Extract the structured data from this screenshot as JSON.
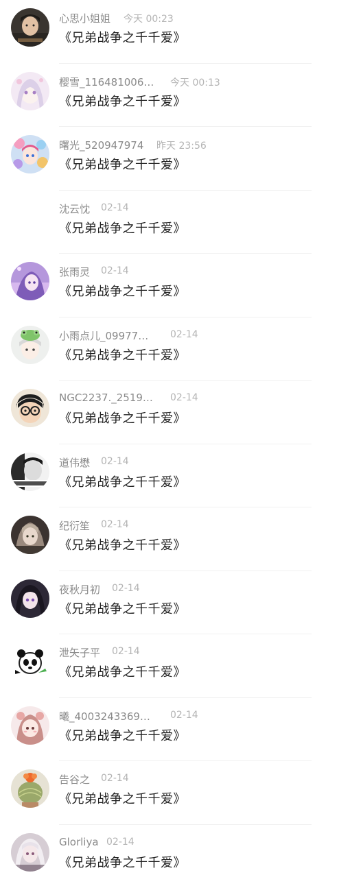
{
  "messages": [
    {
      "name": "心思小姐姐",
      "time": "今天 00:23",
      "text": "《兄弟战争之千千爱》",
      "avatar": "avatar-boy-photo"
    },
    {
      "name": "樱雪_116481006…",
      "time": "今天 00:13",
      "text": "《兄弟战争之千千爱》",
      "avatar": "avatar-anime-pastel"
    },
    {
      "name": "曙光_520947974",
      "time": "昨天 23:56",
      "text": "《兄弟战争之千千爱》",
      "avatar": "avatar-anime-colorful"
    },
    {
      "name": "沈云忱",
      "time": "02-14",
      "text": "《兄弟战争之千千爱》",
      "avatar": "avatar-blank"
    },
    {
      "name": "张雨灵",
      "time": "02-14",
      "text": "《兄弟战争之千千爱》",
      "avatar": "avatar-anime-purple"
    },
    {
      "name": "小雨点儿_09977…",
      "time": "02-14",
      "text": "《兄弟战争之千千爱》",
      "avatar": "avatar-anime-frog-hat"
    },
    {
      "name": "NGC2237._2519…",
      "time": "02-14",
      "text": "《兄弟战争之千千爱》",
      "avatar": "avatar-glasses-cartoon"
    },
    {
      "name": "道伟懋",
      "time": "02-14",
      "text": "《兄弟战争之千千爱》",
      "avatar": "avatar-bw-photo"
    },
    {
      "name": "纪衍笙",
      "time": "02-14",
      "text": "《兄弟战争之千千爱》",
      "avatar": "avatar-anime-dark"
    },
    {
      "name": "夜秋月初",
      "time": "02-14",
      "text": "《兄弟战争之千千爱》",
      "avatar": "avatar-anime-girl-dark"
    },
    {
      "name": "泄矢子平",
      "time": "02-14",
      "text": "《兄弟战争之千千爱》",
      "avatar": "avatar-panda-cartoon"
    },
    {
      "name": "曦_4003243369…",
      "time": "02-14",
      "text": "《兄弟战争之千千爱》",
      "avatar": "avatar-anime-pink-bear"
    },
    {
      "name": "告谷之",
      "time": "02-14",
      "text": "《兄弟战争之千千爱》",
      "avatar": "avatar-cactus-photo"
    },
    {
      "name": "Glorliya",
      "time": "02-14",
      "text": "《兄弟战争之千千爱》",
      "avatar": "avatar-anime-silver"
    }
  ],
  "colors": {
    "name": "#8a8a8a",
    "time": "#b4b4b4",
    "message": "#222222",
    "divider": "#f1f1f1"
  }
}
